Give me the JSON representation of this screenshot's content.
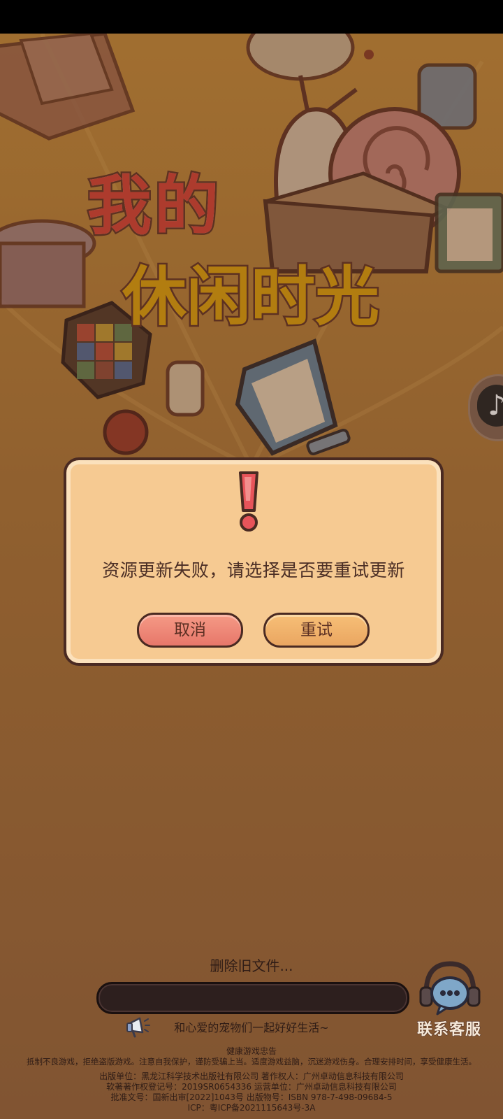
{
  "game": {
    "title_line1": "我的",
    "title_line2": "休闲时光"
  },
  "dialog": {
    "message": "资源更新失败，请选择是否要重试更新",
    "cancel_label": "取消",
    "retry_label": "重试",
    "icon": "exclamation-icon"
  },
  "loading": {
    "status_text": "删除旧文件...",
    "progress": 0
  },
  "tips": {
    "text": "和心爱的宠物们一起好好生活~",
    "icon": "megaphone-icon"
  },
  "customer_service": {
    "label": "联系客服",
    "icon": "headset-chat-icon"
  },
  "footer": {
    "heading": "健康游戏忠告",
    "advice": "抵制不良游戏，拒绝盗版游戏。注意自我保护，谨防受骗上当。适度游戏益脑，沉迷游戏伤身。合理安排时间，享受健康生活。",
    "publisher_line": "出版单位：黑龙江科学技术出版社有限公司    著作权人：广州卓动信息科技有限公司",
    "copyright_line": "软著著作权登记号：2019SR0654336    运营单位：广州卓动信息科技有限公司",
    "approval_line": "批准文号：国新出审[2022]1043号    出版物号：ISBN 978-7-498-09684-5",
    "icp_line": "ICP：粤ICP备2021115643号-3A"
  },
  "colors": {
    "background": "#b07a3d",
    "dialog_bg": "#f6ca92",
    "cancel_button": "#e7776a",
    "retry_button": "#eaa661",
    "outline": "#4a2a22"
  }
}
